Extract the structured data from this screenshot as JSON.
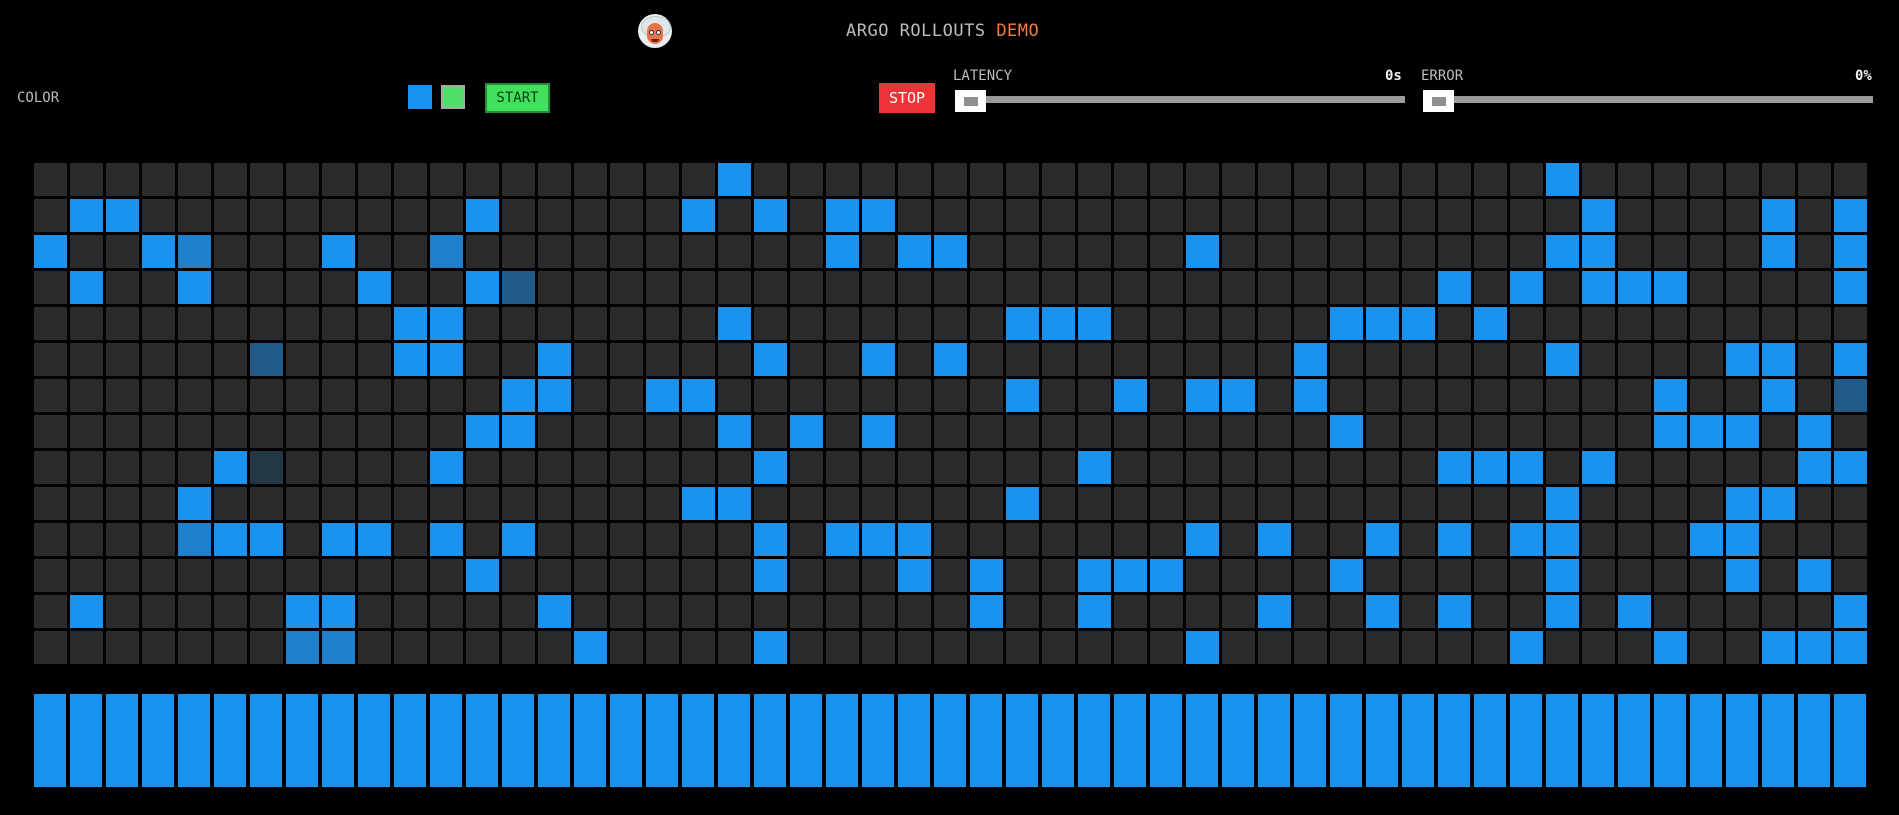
{
  "header": {
    "title_prefix": "ARGO ROLLOUTS",
    "title_accent": "DEMO",
    "logo_icon": "argo-mascot-icon"
  },
  "controls": {
    "color_label": "COLOR",
    "swatches": [
      "#1a93f0",
      "#4fe06a"
    ],
    "start_label": "START",
    "stop_label": "STOP",
    "latency": {
      "label": "LATENCY",
      "value": "0s",
      "level": 0
    },
    "error": {
      "label": "ERROR",
      "value": "0%",
      "level": 0
    }
  },
  "colors": {
    "background": "#000000",
    "cell_empty": "#2b2b2b",
    "cell_active": "#1a93f0",
    "start_button": "#41e05d",
    "stop_button": "#ec3338",
    "title_accent": "#f07f3a"
  },
  "grid": {
    "columns": 51,
    "rows": 14,
    "note_values": "0=empty, 1=bright blue, 2=medium blue, 3=dim blue, 4=faint blue",
    "cells": [
      "000000000000000000010000000000000000000000100000000",
      "011000000000100000101011000000000000000000010000101",
      "100120001002000000000010110000001000000000110000101",
      "010010000100130000000000000000000000000101011100001",
      "000000000011000000010000000111000000111010000000000",
      "000000300011001000001001010000000001000000100001101",
      "000000000000011001100000000100101101000000000100103",
      "000000000000110000010101000000000000100000000111010",
      "000001400001000000001000000001000000000111010000011",
      "000010000000000000110000000100000000000000100001100",
      "000021101101010000001011100000001010010101100011000",
      "000000000000100000001000101001110000100000100001010",
      "010000011000001000000000001001000010010100101000001",
      "000000022000000100001000000000001000000001000100111"
    ],
    "bar_count": 51
  }
}
